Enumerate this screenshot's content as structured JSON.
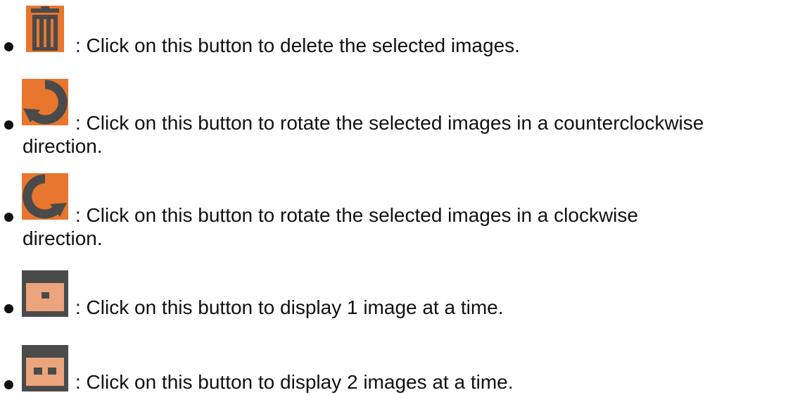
{
  "items": [
    {
      "icon": "trash-can-icon",
      "line1": ": Click on this button to delete the selected images.",
      "line2": ""
    },
    {
      "icon": "rotate-counterclockwise-icon",
      "line1": ": Click on this button to rotate the selected images in a counterclockwise",
      "line2": "direction."
    },
    {
      "icon": "rotate-clockwise-icon",
      "line1": ": Click on this button to rotate the selected images in a clockwise",
      "line2": "direction."
    },
    {
      "icon": "single-image-view-icon",
      "line1": ": Click on this button to display 1 image at a time.",
      "line2": ""
    },
    {
      "icon": "two-image-view-icon",
      "line1": ": Click on this button to display 2 images at a time.",
      "line2": ""
    }
  ],
  "colors": {
    "orange": "#e8762e",
    "dark_gray": "#4a4a4a",
    "light_orange": "#eba47c",
    "text": "#111111"
  }
}
